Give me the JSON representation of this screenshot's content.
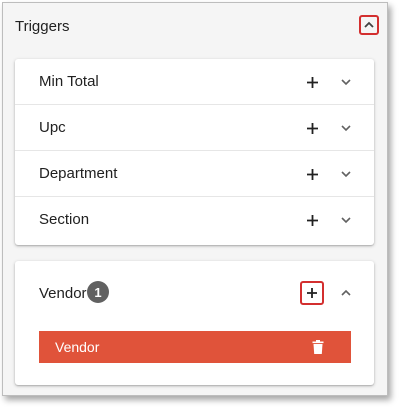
{
  "header": {
    "title": "Triggers",
    "collapse_icon": "chevron-up-icon"
  },
  "triggers": [
    {
      "label": "Min Total",
      "add_icon": "plus-icon",
      "expand_icon": "chevron-down-icon"
    },
    {
      "label": "Upc",
      "add_icon": "plus-icon",
      "expand_icon": "chevron-down-icon"
    },
    {
      "label": "Department",
      "add_icon": "plus-icon",
      "expand_icon": "chevron-down-icon"
    },
    {
      "label": "Section",
      "add_icon": "plus-icon",
      "expand_icon": "chevron-down-icon"
    }
  ],
  "vendor": {
    "label": "Vendor",
    "count": "1",
    "add_icon": "plus-icon",
    "collapse_icon": "chevron-up-icon",
    "items": [
      {
        "label": "Vendor",
        "delete_icon": "trash-icon"
      }
    ]
  },
  "colors": {
    "highlight_border": "#d32f2f",
    "vendor_item_bg": "#e0533a",
    "badge_bg": "#616161"
  }
}
